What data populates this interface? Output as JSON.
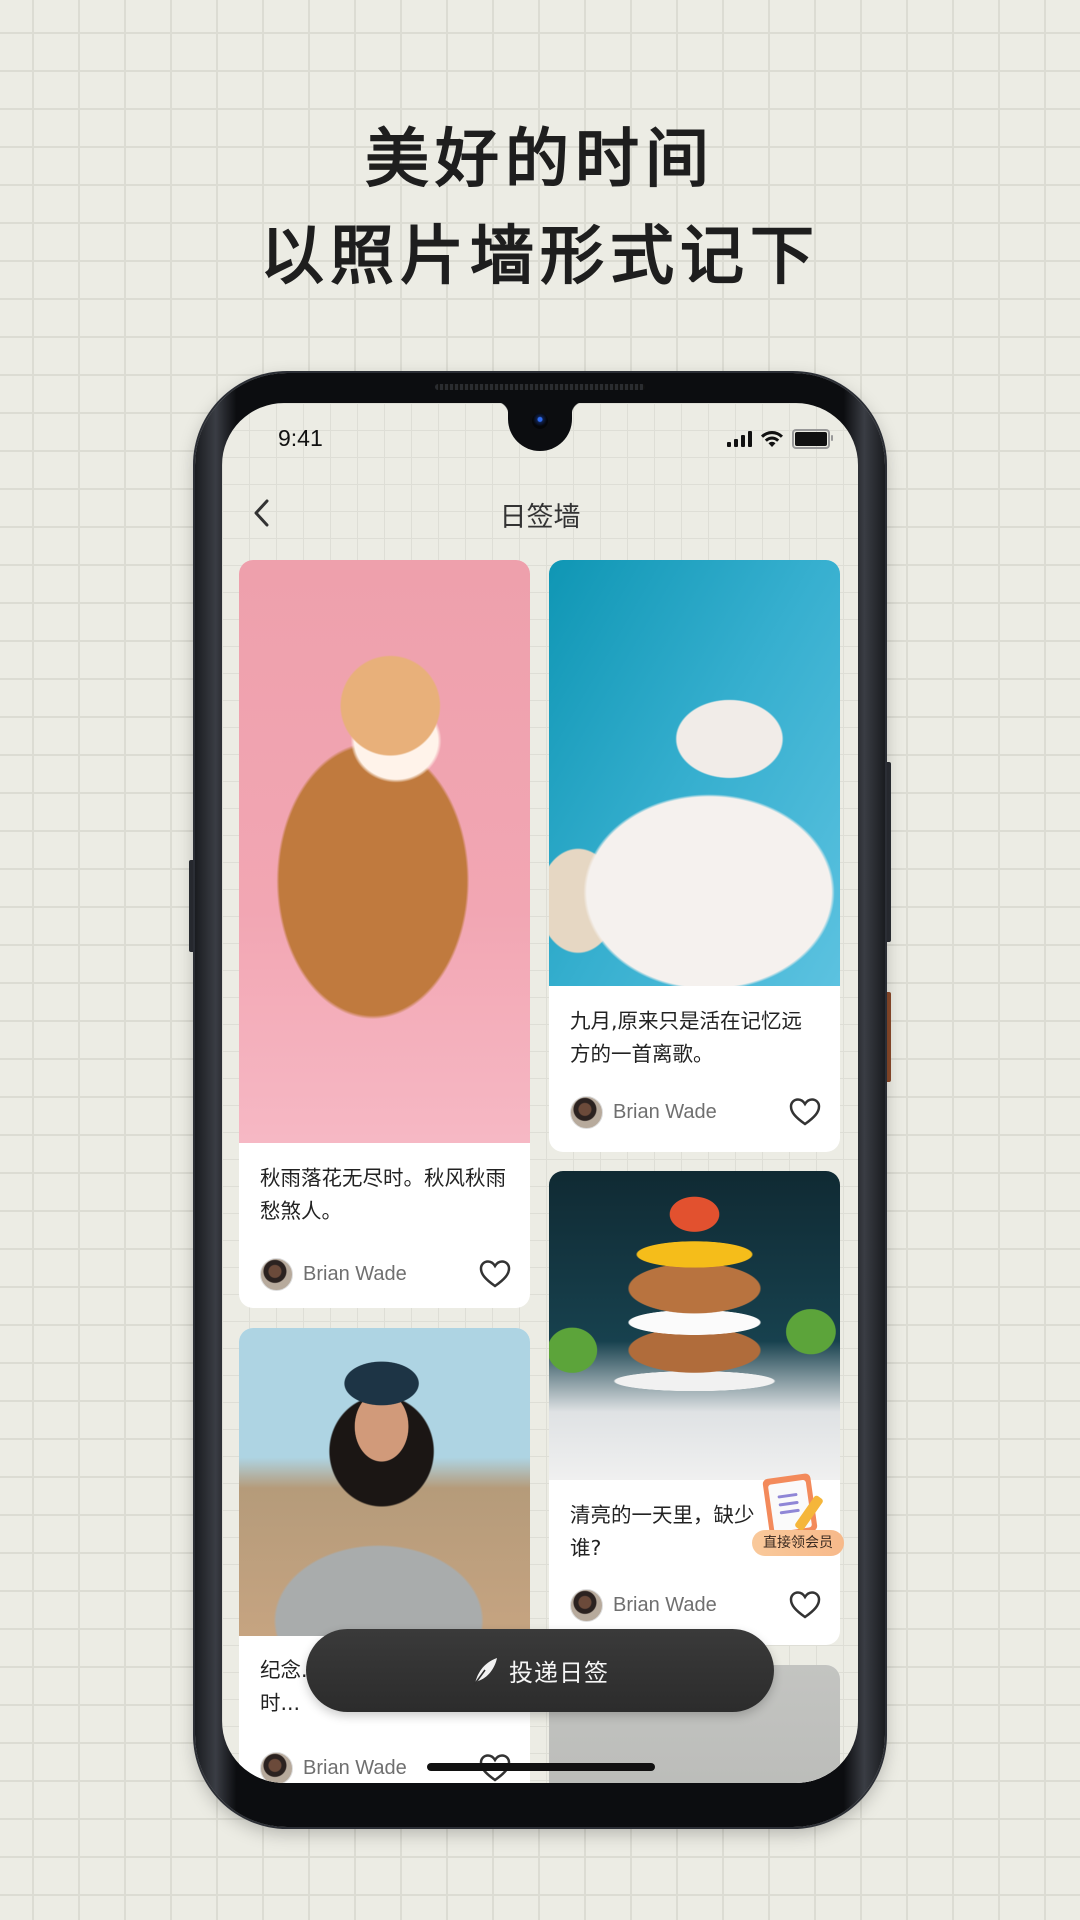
{
  "promo": {
    "headline_line1": "美好的时间",
    "headline_line2": "以照片墙形式记下",
    "background_color": "#ECECE4"
  },
  "status_bar": {
    "time": "9:41",
    "icons": [
      "signal-icon",
      "wifi-icon",
      "battery-icon"
    ]
  },
  "nav": {
    "back_icon": "chevron-left-icon",
    "title": "日签墙"
  },
  "feed": {
    "left_column": [
      {
        "image": "orange cat on pink background",
        "text": "秋雨落花无尽时。秋风秋雨愁煞人。",
        "author": "Brian Wade",
        "liked": false
      },
      {
        "image": "woman in beanie and glasses",
        "text": "纪念... 的帽子。可惜，由于时...",
        "author": "Brian Wade",
        "liked": false
      }
    ],
    "right_column": [
      {
        "image": "white cat on blue background",
        "text": "九月,原来只是活在记忆远方的一首离歌。",
        "author": "Brian Wade",
        "liked": false
      },
      {
        "image": "layered cake with fruit",
        "text": "清亮的一天里，缺少谁?",
        "author": "Brian Wade",
        "liked": false
      },
      {
        "image": "chocolate cake with sprinkles"
      }
    ]
  },
  "member_badge": {
    "label": "直接领会员"
  },
  "post_button": {
    "icon": "feather-icon",
    "label": "投递日签",
    "color": "#333333"
  }
}
